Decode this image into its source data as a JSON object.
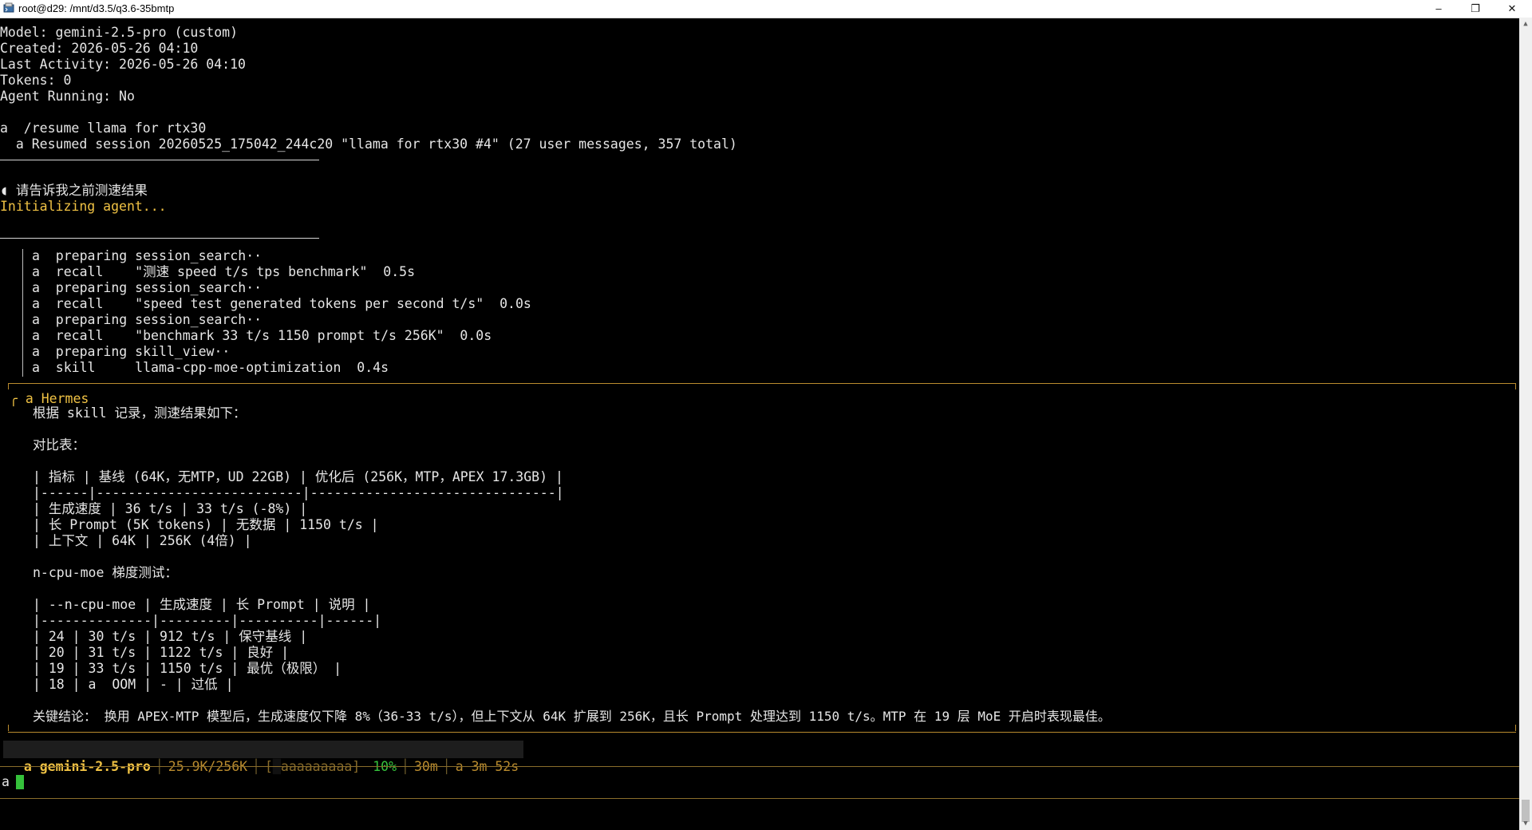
{
  "window": {
    "title": "root@d29: /mnt/d3.5/q3.6-35bmtp",
    "minimize": "–",
    "restore": "❐",
    "close": "✕"
  },
  "session_info": [
    "Model: gemini-2.5-pro (custom)",
    "Created: 2026-05-26 04:10",
    "Last Activity: 2026-05-26 04:10",
    "Tokens: 0",
    "Agent Running: No"
  ],
  "resume_command": "a  /resume llama for rtx30",
  "resume_result": "  a Resumed session 20260525_175042_244c20 \"llama for rtx30 #4\" (27 user messages, 357 total)",
  "user_prompt": "◖ 请告诉我之前测速结果",
  "initializing": "Initializing agent...",
  "tool_calls": [
    "a  preparing session_search··",
    "a  recall    \"测速 speed t/s tps benchmark\"  0.5s",
    "a  preparing session_search··",
    "a  recall    \"speed test generated tokens per second t/s\"  0.0s",
    "a  preparing session_search··",
    "a  recall    \"benchmark 33 t/s 1150 prompt t/s 256K\"  0.0s",
    "a  preparing skill_view··",
    "a  skill     llama-cpp-moe-optimization  0.4s"
  ],
  "hermes": {
    "label": "╭ a Hermes ",
    "lines": [
      "根据 skill 记录，测速结果如下：",
      "",
      "对比表：",
      "",
      "| 指标 | 基线 (64K，无MTP，UD 22GB) | 优化后 (256K，MTP，APEX 17.3GB) |",
      "|------|--------------------------|-------------------------------|",
      "| 生成速度 | 36 t/s | 33 t/s (-8%) |",
      "| 长 Prompt (5K tokens) | 无数据 | 1150 t/s |",
      "| 上下文 | 64K | 256K (4倍) |",
      "",
      "n-cpu-moe 梯度测试：",
      "",
      "| --n-cpu-moe | 生成速度 | 长 Prompt | 说明 |",
      "|--------------|---------|----------|------|",
      "| 24 | 30 t/s | 912 t/s | 保守基线 |",
      "| 20 | 31 t/s | 1122 t/s | 良好 |",
      "| 19 | 33 t/s | 1150 t/s | 最优（极限） |",
      "| 18 | a  OOM | - | 过低 |",
      "",
      "关键结论： 换用 APEX-MTP 模型后，生成速度仅下降 8%（36-33 t/s），但上下文从 64K 扩展到 256K，且长 Prompt 处理达到 1150 t/s。MTP 在 19 层 MoE 开启时表现最佳。"
    ]
  },
  "status_bar": {
    "model": "a gemini-2.5-pro",
    "context": "25.9K/256K",
    "bar_open": "[",
    "bar_fill": "█",
    "bar_rest": "aaaaaaaaa]",
    "percent": "10%",
    "progress_fraction": 0.1,
    "duration": "30m",
    "elapsed": "a 3m 52s"
  },
  "input_prompt": "a",
  "colors": {
    "accent": "#f0c244",
    "border": "#b98b2e",
    "green": "#35c13b",
    "background": "#000000"
  }
}
